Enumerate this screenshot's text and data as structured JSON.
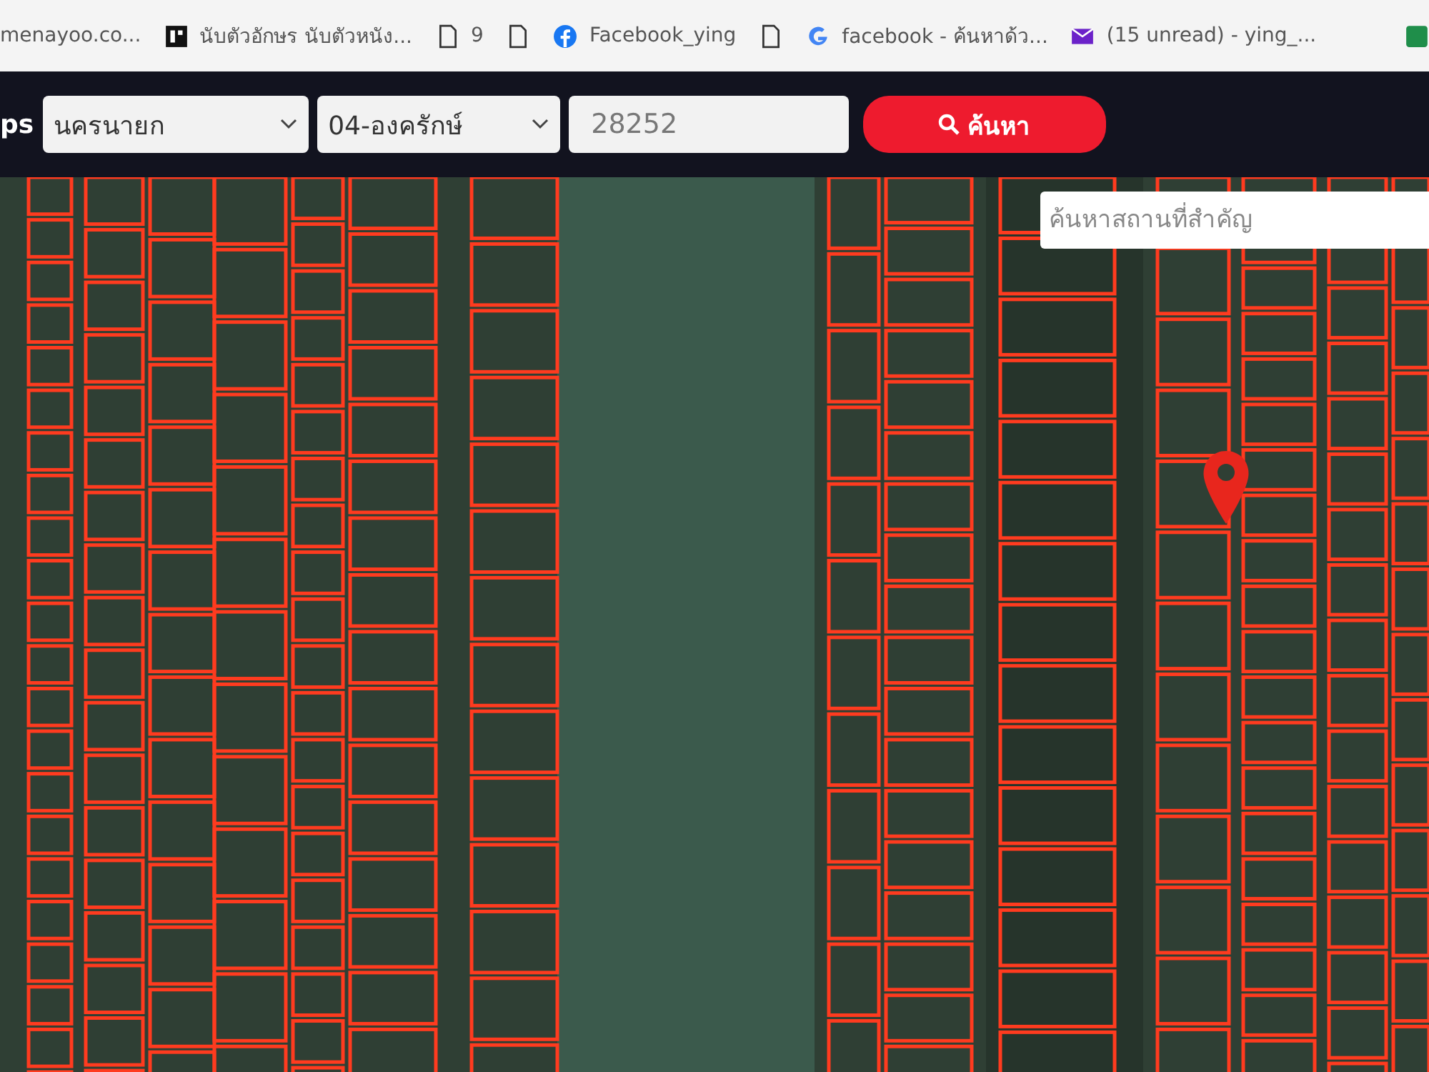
{
  "bookmarks": [
    {
      "kind": "text",
      "label": "menayoo.co..."
    },
    {
      "kind": "app",
      "label": "นับตัวอักษร นับตัวหนัง..."
    },
    {
      "kind": "page",
      "label": "9"
    },
    {
      "kind": "page"
    },
    {
      "kind": "facebook",
      "label": "Facebook_ying"
    },
    {
      "kind": "page"
    },
    {
      "kind": "google",
      "label": "facebook - ค้นหาด้ว..."
    },
    {
      "kind": "mail",
      "label": "(15 unread) - ying_..."
    }
  ],
  "header": {
    "brand": "ps",
    "province": "นครนายก",
    "district": "04-องครักษ์",
    "parcel_value": "28252",
    "search_button": "ค้นหา"
  },
  "map": {
    "place_search": {
      "placeholder": "ค้นหาสถานที่สำคัญ"
    }
  }
}
